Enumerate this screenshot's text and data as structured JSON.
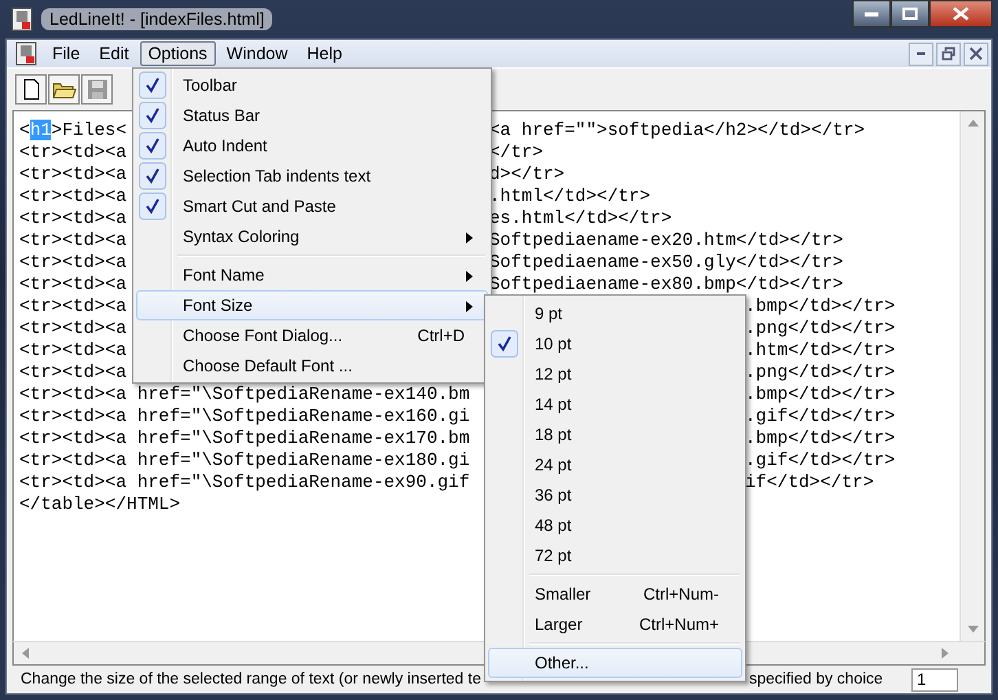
{
  "window": {
    "title": "LedLineIt! - [indexFiles.html]"
  },
  "menubar": [
    {
      "label": "File",
      "selected": false
    },
    {
      "label": "Edit",
      "selected": false
    },
    {
      "label": "Options",
      "selected": true
    },
    {
      "label": "Window",
      "selected": false
    },
    {
      "label": "Help",
      "selected": false
    }
  ],
  "toolbar": [
    {
      "kind": "new",
      "disabled": false
    },
    {
      "kind": "open",
      "disabled": false
    },
    {
      "kind": "save",
      "disabled": true
    }
  ],
  "editor": {
    "lines": [
      {
        "segments": [
          {
            "text": "<",
            "selected": false
          },
          {
            "text": "h1",
            "selected": true
          },
          {
            "text": ">Files<",
            "selected": false
          }
        ],
        "right": "<a href=\"\">softpedia</h2></td></tr>"
      },
      {
        "segments": [
          {
            "text": "<tr><td><a",
            "selected": false
          }
        ],
        "right": "</tr>"
      },
      {
        "segments": [
          {
            "text": "<tr><td><a",
            "selected": false
          }
        ],
        "right": "d></tr>"
      },
      {
        "segments": [
          {
            "text": "<tr><td><a",
            "selected": false
          }
        ],
        "right": ".html</td></tr>"
      },
      {
        "segments": [
          {
            "text": "<tr><td><a",
            "selected": false
          }
        ],
        "right": "es.html</td></tr>"
      },
      {
        "segments": [
          {
            "text": "<tr><td><a",
            "selected": false
          }
        ],
        "right": "Softpediaename-ex20.htm</td></tr>"
      },
      {
        "segments": [
          {
            "text": "<tr><td><a",
            "selected": false
          }
        ],
        "right": "Softpediaename-ex50.gly</td></tr>"
      },
      {
        "segments": [
          {
            "text": "<tr><td><a",
            "selected": false
          }
        ],
        "right": "Softpediaename-ex80.bmp</td></tr>"
      },
      {
        "segments": [
          {
            "text": "<tr><td><a",
            "selected": false
          }
        ],
        "right": ".bmp</td></tr>"
      },
      {
        "segments": [
          {
            "text": "<tr><td><a",
            "selected": false
          }
        ],
        "right": ".png</td></tr>"
      },
      {
        "segments": [
          {
            "text": "<tr><td><a",
            "selected": false
          }
        ],
        "right": ".htm</td></tr>"
      },
      {
        "segments": [
          {
            "text": "<tr><td><a",
            "selected": false
          }
        ],
        "right": ".png</td></tr>"
      },
      {
        "segments": [
          {
            "text": "<tr><td><a href=\"\\SoftpediaRename-ex140.bm",
            "selected": false
          }
        ],
        "right": ".bmp</td></tr>"
      },
      {
        "segments": [
          {
            "text": "<tr><td><a href=\"\\SoftpediaRename-ex160.gi",
            "selected": false
          }
        ],
        "right": ".gif</td></tr>"
      },
      {
        "segments": [
          {
            "text": "<tr><td><a href=\"\\SoftpediaRename-ex170.bm",
            "selected": false
          }
        ],
        "right": ".bmp</td></tr>"
      },
      {
        "segments": [
          {
            "text": "<tr><td><a href=\"\\SoftpediaRename-ex180.gi",
            "selected": false
          }
        ],
        "right": ".gif</td></tr>"
      },
      {
        "segments": [
          {
            "text": "<tr><td><a href=\"\\SoftpediaRename-ex90.gif",
            "selected": false
          }
        ],
        "right": "if</td></tr>"
      },
      {
        "segments": [
          {
            "text": "</table></HTML>",
            "selected": false
          }
        ]
      }
    ]
  },
  "options_menu": {
    "items": [
      {
        "kind": "item",
        "label": "Toolbar",
        "checked": true
      },
      {
        "kind": "item",
        "label": "Status Bar",
        "checked": true
      },
      {
        "kind": "item",
        "label": "Auto Indent",
        "checked": true
      },
      {
        "kind": "item",
        "label": "Selection Tab indents text",
        "checked": true
      },
      {
        "kind": "item",
        "label": "Smart Cut and Paste",
        "checked": true
      },
      {
        "kind": "submenu",
        "label": "Syntax Coloring",
        "selected": false
      },
      {
        "kind": "separator"
      },
      {
        "kind": "submenu",
        "label": "Font Name",
        "selected": false
      },
      {
        "kind": "submenu",
        "label": "Font Size",
        "selected": true
      },
      {
        "kind": "item",
        "label": "Choose Font Dialog...",
        "shortcut": "Ctrl+D",
        "checked": false
      },
      {
        "kind": "item",
        "label": "Choose Default Font ...",
        "checked": false
      }
    ]
  },
  "font_size_menu": {
    "items": [
      {
        "kind": "item",
        "label": "9 pt",
        "checked": false
      },
      {
        "kind": "item",
        "label": "10 pt",
        "checked": true
      },
      {
        "kind": "item",
        "label": "12 pt",
        "checked": false
      },
      {
        "kind": "item",
        "label": "14 pt",
        "checked": false
      },
      {
        "kind": "item",
        "label": "18 pt",
        "checked": false
      },
      {
        "kind": "item",
        "label": "24 pt",
        "checked": false
      },
      {
        "kind": "item",
        "label": "36 pt",
        "checked": false
      },
      {
        "kind": "item",
        "label": "48 pt",
        "checked": false
      },
      {
        "kind": "item",
        "label": "72 pt",
        "checked": false
      },
      {
        "kind": "separator"
      },
      {
        "kind": "item",
        "label": "Smaller",
        "shortcut": "Ctrl+Num-",
        "checked": false
      },
      {
        "kind": "item",
        "label": "Larger",
        "shortcut": "Ctrl+Num+",
        "checked": false
      },
      {
        "kind": "separator"
      },
      {
        "kind": "item",
        "label": "Other...",
        "checked": false,
        "selected": true
      }
    ]
  },
  "status_bar": {
    "text_left": "Change the size of the selected range of text (or newly inserted te",
    "text_right": "specified by choice",
    "line": "1"
  }
}
